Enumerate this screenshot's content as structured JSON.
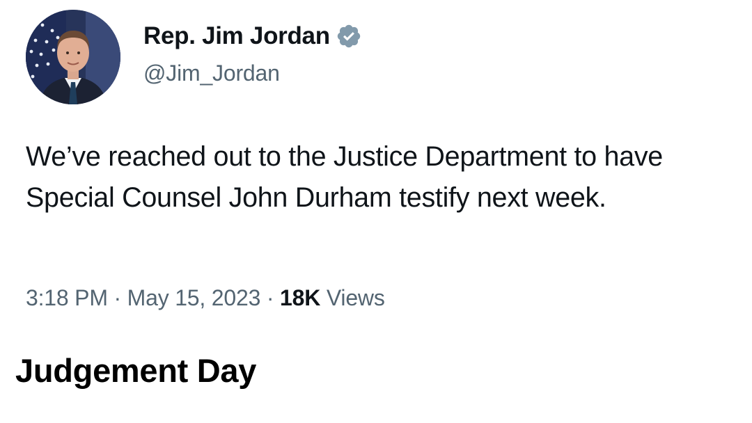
{
  "tweet": {
    "author": {
      "display_name": "Rep. Jim Jordan",
      "handle": "@Jim_Jordan",
      "verified": true,
      "verified_color": "#829aab"
    },
    "text": "We’ve reached out to the Justice Department to have Special Counsel John Durham testify next week.",
    "time": "3:18 PM",
    "separator": "·",
    "date": "May 15, 2023",
    "views_count": "18K",
    "views_label": "Views"
  },
  "caption": "Judgement Day",
  "colors": {
    "text_primary": "#0f1419",
    "text_secondary": "#536471",
    "background": "#ffffff"
  },
  "icons": {
    "avatar": "profile-photo",
    "badge": "verified-badge-icon"
  }
}
